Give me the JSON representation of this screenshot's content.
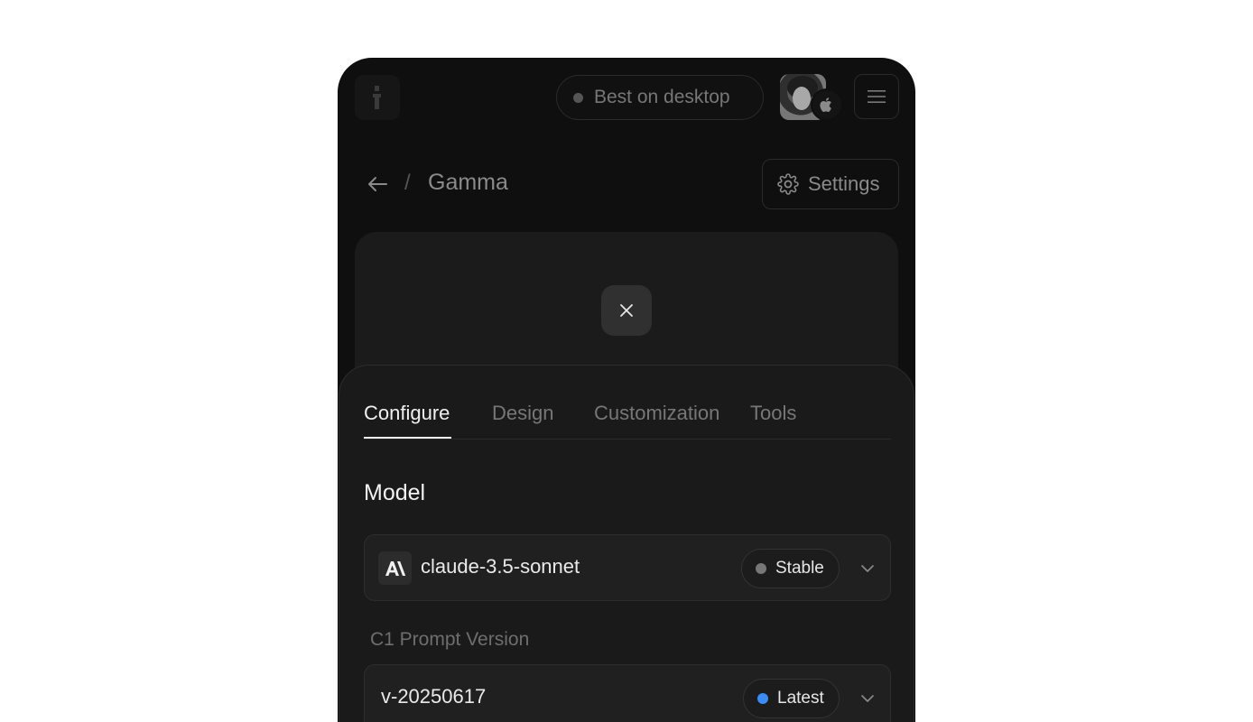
{
  "header": {
    "desktop_pill": "Best on desktop"
  },
  "breadcrumb": {
    "separator": "/",
    "title": "Gamma"
  },
  "settings_label": "Settings",
  "tabs": [
    {
      "label": "Configure",
      "active": true
    },
    {
      "label": "Design",
      "active": false
    },
    {
      "label": "Customization",
      "active": false
    },
    {
      "label": "Tools",
      "active": false
    }
  ],
  "model_section": {
    "title": "Model",
    "value": "claude-3.5-sonnet",
    "badge": "Stable",
    "badge_color": "#777777"
  },
  "prompt_version": {
    "label": "C1 Prompt Version",
    "value": "v-20250617",
    "badge": "Latest",
    "badge_color": "#3b8cf5"
  }
}
